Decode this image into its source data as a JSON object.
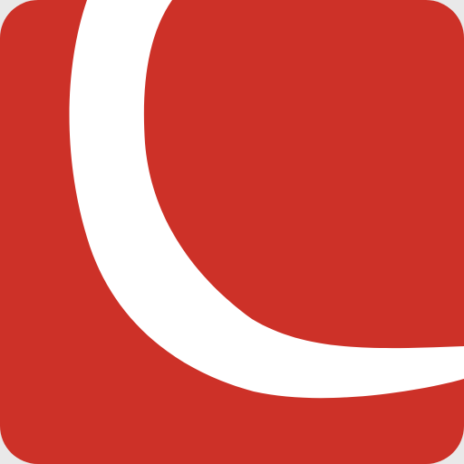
{
  "app_icon": {
    "icon_name": "white-crescent-swoosh-logo",
    "colors": {
      "background": "#cd3128",
      "mark": "#ffffff",
      "canvas_edge": "#e9e9e9"
    }
  }
}
